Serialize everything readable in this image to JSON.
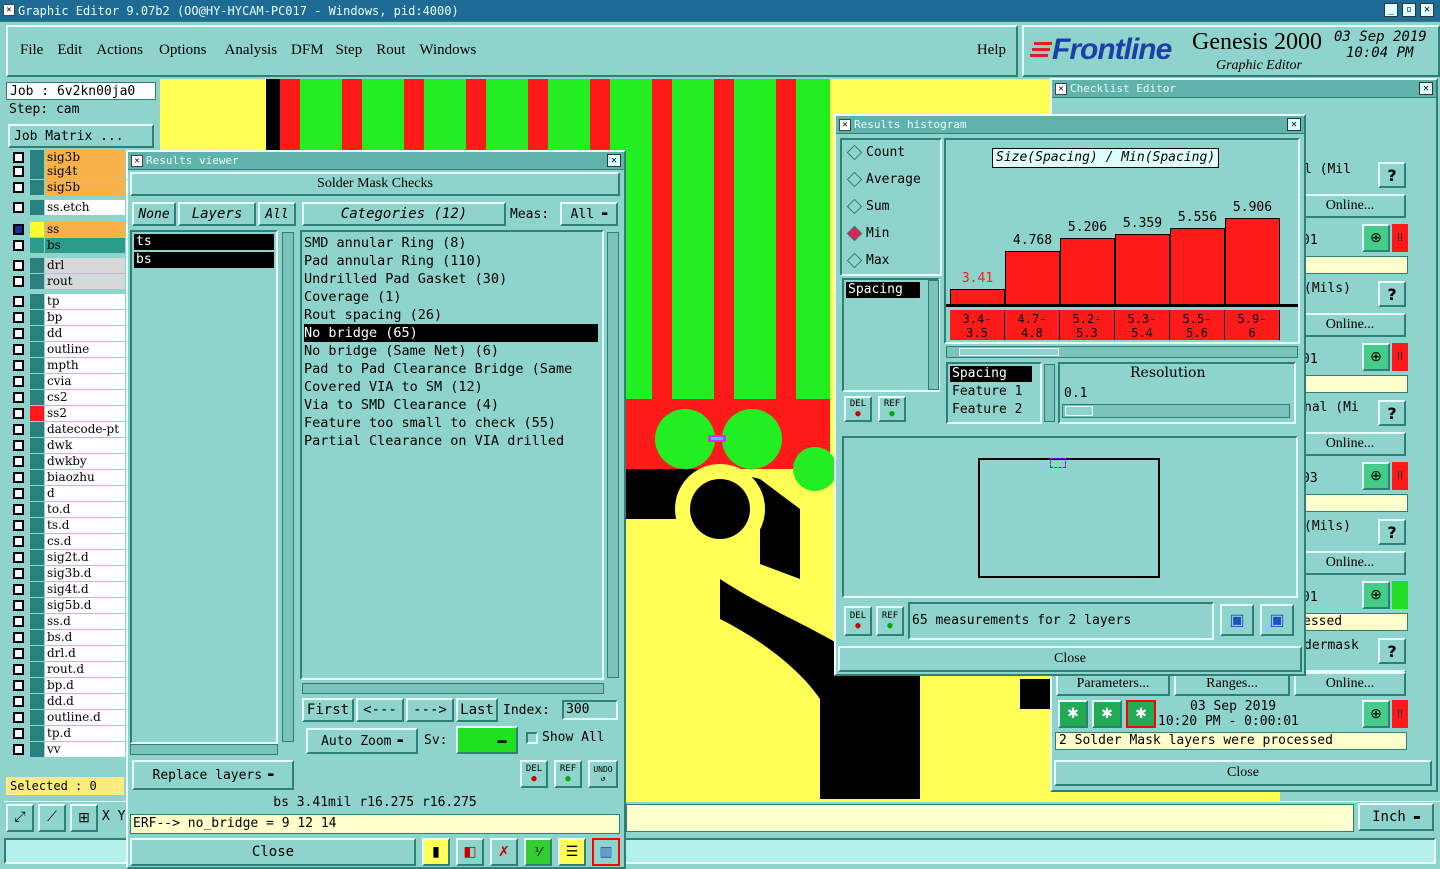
{
  "app": {
    "title": "Graphic Editor 9.07b2 (OO@HY-HYCAM-PC017 - Windows, pid:4000)",
    "menu": [
      "File",
      "Edit",
      "Actions",
      "Options",
      "Analysis",
      "DFM",
      "Step",
      "Rout",
      "Windows"
    ],
    "help": "Help",
    "brand": "Frontline",
    "product": "Genesis 2000",
    "product_sub": "Graphic Editor",
    "date": "03 Sep 2019",
    "time": "10:04 PM"
  },
  "job": {
    "job_label": "Job : 6v2kn00ja0",
    "step_label": "Step: cam",
    "matrix_button": "Job Matrix ..."
  },
  "layers": [
    {
      "name": "sig3b",
      "color": "#f7b24a",
      "swatch": "#2a7f7f"
    },
    {
      "name": "sig4t",
      "color": "#f7b24a",
      "swatch": "#2a7f7f"
    },
    {
      "name": "sig5b",
      "color": "#f7b24a",
      "swatch": "#2a7f7f"
    },
    {
      "name": "ss.etch",
      "color": "#ffffff",
      "swatch": "#2a7f7f"
    },
    {
      "name": "ss",
      "color": "#f7b24a",
      "swatch": "#ffff30"
    },
    {
      "name": "bs",
      "color": "#2a9c8c",
      "swatch": "#2a9c8c"
    },
    {
      "name": "drl",
      "color": "#d8d8d8",
      "swatch": "#2a7f7f"
    },
    {
      "name": "rout",
      "color": "#d8d8d8",
      "swatch": "#2a7f7f"
    },
    {
      "name": "tp",
      "color": "#ffffff",
      "swatch": "#2a7f7f"
    },
    {
      "name": "bp",
      "color": "#ffffff",
      "swatch": "#2a7f7f"
    },
    {
      "name": "dd",
      "color": "#ffffff",
      "swatch": "#2a7f7f"
    },
    {
      "name": "outline",
      "color": "#ffffff",
      "swatch": "#2a7f7f"
    },
    {
      "name": "mpth",
      "color": "#ffffff",
      "swatch": "#2a7f7f"
    },
    {
      "name": "cvia",
      "color": "#ffffff",
      "swatch": "#2a7f7f"
    },
    {
      "name": "cs2",
      "color": "#ffffff",
      "swatch": "#2a7f7f"
    },
    {
      "name": "ss2",
      "color": "#ffffff",
      "swatch": "#ff1a1a"
    },
    {
      "name": "datecode-pt",
      "color": "#ffffff",
      "swatch": "#2a7f7f"
    },
    {
      "name": "dwk",
      "color": "#ffffff",
      "swatch": "#2a7f7f"
    },
    {
      "name": "dwkby",
      "color": "#ffffff",
      "swatch": "#2a7f7f"
    },
    {
      "name": "biaozhu",
      "color": "#ffffff",
      "swatch": "#2a7f7f"
    },
    {
      "name": "d",
      "color": "#ffffff",
      "swatch": "#2a7f7f"
    },
    {
      "name": "to.d",
      "color": "#ffffff",
      "swatch": "#2a7f7f"
    },
    {
      "name": "ts.d",
      "color": "#ffffff",
      "swatch": "#2a7f7f"
    },
    {
      "name": "cs.d",
      "color": "#ffffff",
      "swatch": "#2a7f7f"
    },
    {
      "name": "sig2t.d",
      "color": "#ffffff",
      "swatch": "#2a7f7f"
    },
    {
      "name": "sig3b.d",
      "color": "#ffffff",
      "swatch": "#2a7f7f"
    },
    {
      "name": "sig4t.d",
      "color": "#ffffff",
      "swatch": "#2a7f7f"
    },
    {
      "name": "sig5b.d",
      "color": "#ffffff",
      "swatch": "#2a7f7f"
    },
    {
      "name": "ss.d",
      "color": "#ffffff",
      "swatch": "#2a7f7f"
    },
    {
      "name": "bs.d",
      "color": "#ffffff",
      "swatch": "#2a7f7f"
    },
    {
      "name": "drl.d",
      "color": "#ffffff",
      "swatch": "#2a7f7f"
    },
    {
      "name": "rout.d",
      "color": "#ffffff",
      "swatch": "#2a7f7f"
    },
    {
      "name": "bp.d",
      "color": "#ffffff",
      "swatch": "#2a7f7f"
    },
    {
      "name": "dd.d",
      "color": "#ffffff",
      "swatch": "#2a7f7f"
    },
    {
      "name": "outline.d",
      "color": "#ffffff",
      "swatch": "#2a7f7f"
    },
    {
      "name": "tp.d",
      "color": "#ffffff",
      "swatch": "#2a7f7f"
    },
    {
      "name": "vv",
      "color": "#ffffff",
      "swatch": "#2a7f7f"
    }
  ],
  "selected": "Selected : 0",
  "coord_prefix": "X Y",
  "units": "Inch",
  "results_viewer": {
    "title": "Results viewer",
    "header": "Solder Mask Checks",
    "none": "None",
    "layers_label": "Layers",
    "all": "All",
    "layer_items": [
      "ts",
      "bs"
    ],
    "categories_label": "Categories (12)",
    "meas_label": "Meas:",
    "meas_value": "All",
    "categories": [
      "SMD annular Ring (8)",
      "Pad annular Ring (110)",
      "Undrilled Pad Gasket (30)",
      "Coverage (1)",
      "Rout spacing (26)",
      "No bridge (65)",
      "No bridge (Same Net) (6)",
      "Pad to Pad Clearance Bridge (Same",
      "Covered VIA to SM (12)",
      "Via to SMD Clearance (4)",
      "Feature too small to check (55)",
      "Partial Clearance on VIA drilled"
    ],
    "first": "First",
    "prev": "<---",
    "next": "--->",
    "last": "Last",
    "index_label": "Index:",
    "index_value": "300",
    "auto_zoom": "Auto Zoom",
    "sv_label": "Sv:",
    "show_all": "Show All",
    "replace_layers": "Replace layers",
    "del": "DEL",
    "ref": "REF",
    "undo": "UNDO",
    "status1": "bs 3.41mil  r16.275  r16.275",
    "status2": "ERF--> no_bridge = 9 12 14",
    "close": "Close"
  },
  "histogram": {
    "title": "Results histogram",
    "stats": [
      "Count",
      "Average",
      "Sum",
      "Min",
      "Max"
    ],
    "selected_stat": "Min",
    "chart_title": "Size(Spacing) / Min(Spacing)",
    "list_item": "Spacing",
    "fields": [
      "Spacing",
      "Feature 1",
      "Feature 2"
    ],
    "resolution_label": "Resolution",
    "resolution_value": "0.1",
    "measurements": "65 measurements for 2 layers",
    "close": "Close",
    "del": "DEL",
    "ref": "REF"
  },
  "chart_data": {
    "type": "bar",
    "title": "Size(Spacing) / Min(Spacing)",
    "categories": [
      "3.4-3.5",
      "4.7-4.8",
      "5.2-5.3",
      "5.3-5.4",
      "5.5-5.6",
      "5.9-6"
    ],
    "category_lines": [
      [
        "3.4-",
        "3.5"
      ],
      [
        "4.7-",
        "4.8"
      ],
      [
        "5.2-",
        "5.3"
      ],
      [
        "5.3-",
        "5.4"
      ],
      [
        "5.5-",
        "5.6"
      ],
      [
        "5.9-",
        "6"
      ]
    ],
    "values": [
      3.41,
      4.768,
      5.206,
      5.359,
      5.556,
      5.906
    ],
    "value_labels": [
      "3.41",
      "4.768",
      "5.206",
      "5.359",
      "5.556",
      "5.906"
    ],
    "ylim": [
      2.9,
      6.2
    ],
    "bar_color": "#ff1a1a"
  },
  "checklist": {
    "title": "Checklist Editor",
    "rows": [
      {
        "label": "l (Mil",
        "online": "Online...",
        "time": "01",
        "status": ""
      },
      {
        "label": "(Mils)",
        "online": "Online...",
        "time": "01",
        "status": ""
      },
      {
        "label": "nal (Mi",
        "online": "Online...",
        "time": "03",
        "status": ""
      },
      {
        "label": "(Mils)",
        "online": "Online...",
        "time": "01",
        "status": "essed"
      },
      {
        "label": "dermask",
        "online": "Online...",
        "time": "",
        "status": ""
      }
    ],
    "parameters": "Parameters...",
    "ranges": "Ranges...",
    "online": "Online...",
    "date": "03 Sep 2019",
    "time": "10:20 PM - 0:00:01",
    "message": "2 Solder Mask layers were processed",
    "close": "Close",
    "q": "?",
    "bang": "!!"
  }
}
